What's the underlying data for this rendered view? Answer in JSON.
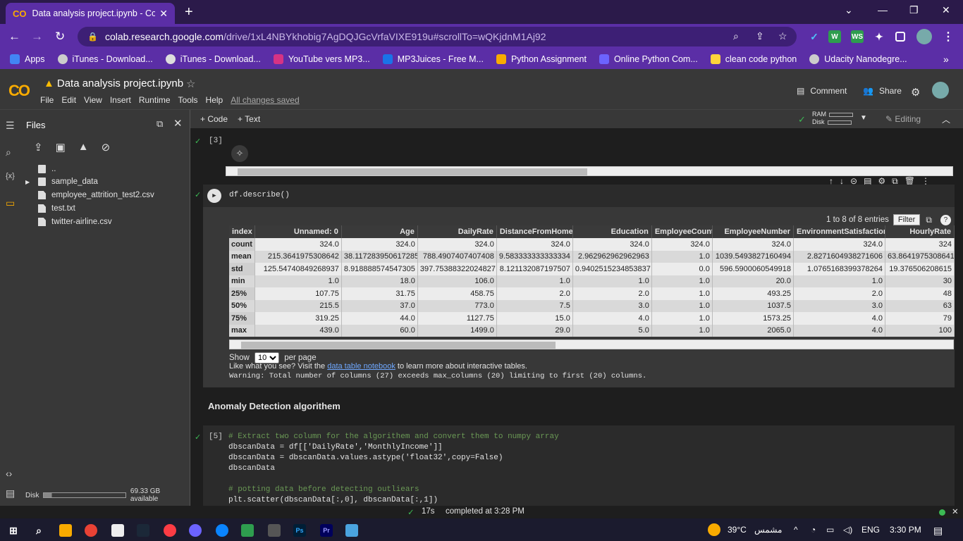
{
  "browser": {
    "tab_title": "Data analysis project.ipynb - Cola",
    "tab_close": "✕",
    "new_tab": "+",
    "url_main": "colab.research.google.com",
    "url_rest": "/drive/1xL4NBYkhobig7AgDQJGcVrfaVIXE919u#scrollTo=wQKjdnM1Aj92",
    "bookmarks": [
      {
        "label": "Apps",
        "color": "#4285f4"
      },
      {
        "label": "iTunes - Download...",
        "color": "#cccccc"
      },
      {
        "label": "iTunes - Download...",
        "color": "#dddddd"
      },
      {
        "label": "YouTube vers MP3...",
        "color": "#d63384"
      },
      {
        "label": "MP3Juices - Free M...",
        "color": "#1a73e8"
      },
      {
        "label": "Python Assignment",
        "color": "#f9ab00"
      },
      {
        "label": "Online Python Com...",
        "color": "#6c63ff"
      },
      {
        "label": "clean code python",
        "color": "#ffd43b"
      },
      {
        "label": "Udacity Nanodegre...",
        "color": "#cccccc"
      }
    ]
  },
  "colab": {
    "logo": "CO",
    "title": "Data analysis project.ipynb",
    "menus": [
      "File",
      "Edit",
      "View",
      "Insert",
      "Runtime",
      "Tools",
      "Help"
    ],
    "saved": "All changes saved",
    "comment": "Comment",
    "share": "Share",
    "code_btn": "+ Code",
    "text_btn": "+ Text",
    "ram": "RAM",
    "disk": "Disk",
    "editing": "Editing"
  },
  "files": {
    "title": "Files",
    "items": [
      {
        "name": "..",
        "type": "folder"
      },
      {
        "name": "sample_data",
        "type": "folder"
      },
      {
        "name": "employee_attrition_test2.csv",
        "type": "file"
      },
      {
        "name": "test.txt",
        "type": "file"
      },
      {
        "name": "twitter-airline.csv",
        "type": "file"
      }
    ],
    "disk_label": "Disk",
    "disk_available": "69.33 GB available",
    "disk_used_fraction": 0.1
  },
  "cells": {
    "cell3_num": "[3]",
    "describe_code": "df.describe()",
    "entries": "1 to 8 of 8 entries",
    "filter": "Filter",
    "table": {
      "headers": [
        "index",
        "Unnamed: 0",
        "Age",
        "DailyRate",
        "DistanceFromHome",
        "Education",
        "EmployeeCount",
        "EmployeeNumber",
        "EnvironmentSatisfaction",
        "HourlyRate"
      ],
      "rows": [
        [
          "count",
          "324.0",
          "324.0",
          "324.0",
          "324.0",
          "324.0",
          "324.0",
          "324.0",
          "324.0",
          "324"
        ],
        [
          "mean",
          "215.3641975308642",
          "38.117283950617285",
          "788.4907407407408",
          "9.583333333333334",
          "2.962962962962963",
          "1.0",
          "1039.5493827160494",
          "2.8271604938271606",
          "63.8641975308641"
        ],
        [
          "std",
          "125.54740849268937",
          "8.918888574547305",
          "397.75388322024827",
          "8.121132087197507",
          "0.9402515234853837",
          "0.0",
          "596.5900060549918",
          "1.0765168399378264",
          "19.376506208615"
        ],
        [
          "min",
          "1.0",
          "18.0",
          "106.0",
          "1.0",
          "1.0",
          "1.0",
          "20.0",
          "1.0",
          "30"
        ],
        [
          "25%",
          "107.75",
          "31.75",
          "458.75",
          "2.0",
          "2.0",
          "1.0",
          "493.25",
          "2.0",
          "48"
        ],
        [
          "50%",
          "215.5",
          "37.0",
          "773.0",
          "7.5",
          "3.0",
          "1.0",
          "1037.5",
          "3.0",
          "63"
        ],
        [
          "75%",
          "319.25",
          "44.0",
          "1127.75",
          "15.0",
          "4.0",
          "1.0",
          "1573.25",
          "4.0",
          "79"
        ],
        [
          "max",
          "439.0",
          "60.0",
          "1499.0",
          "29.0",
          "5.0",
          "1.0",
          "2065.0",
          "4.0",
          "100"
        ]
      ]
    },
    "show": "Show",
    "show_value": "10",
    "per_page": "per page",
    "like_prefix": "Like what you see? Visit the ",
    "like_link": "data table notebook",
    "like_suffix": " to learn more about interactive tables.",
    "warning": "Warning: Total number of columns (27) exceeds max_columns (20) limiting to first (20) columns.",
    "section_title": "Anomaly Detection algorithem",
    "cell5_num": "[5]",
    "code_lines": [
      "# Extract two column for the algorithem and convert them to numpy array",
      "dbscanData = df[['DailyRate','MonthlyIncome']]",
      "dbscanData = dbscanData.values.astype('float32',copy=False)",
      "dbscanData",
      "",
      "# potting data before detecting outliears",
      "plt.scatter(dbscanData[:,0], dbscanData[:,1])"
    ]
  },
  "status": {
    "check": "✓",
    "duration": "17s",
    "completed": "completed at 3:28 PM"
  },
  "taskbar": {
    "weather": "39°C",
    "weather_desc": "مشمس",
    "lang": "ENG",
    "time": "3:30 PM"
  }
}
